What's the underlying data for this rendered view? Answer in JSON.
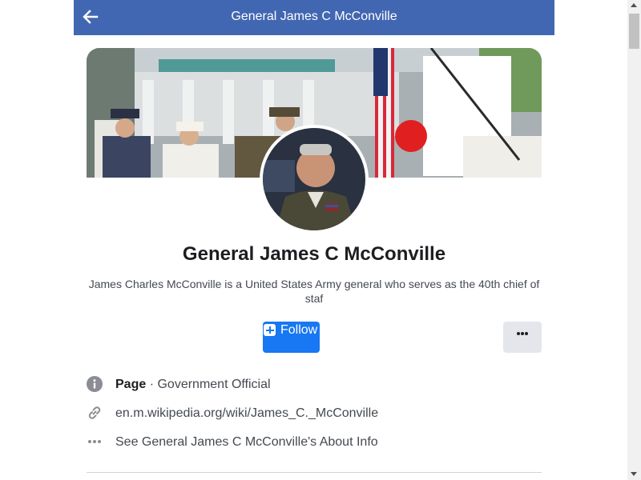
{
  "header": {
    "title": "General James C McConville"
  },
  "profile": {
    "name": "General James C McConville",
    "description": "James Charles McConville is a United States Army general who serves as the 40th chief of staf"
  },
  "actions": {
    "follow_label": "Follow",
    "more_icon": "more-dots-icon"
  },
  "info": {
    "page_label": "Page",
    "separator": " · ",
    "category": "Government Official",
    "website": "en.m.wikipedia.org/wiki/James_C._McConville",
    "about_link": "See General James C McConville's About Info"
  },
  "colors": {
    "header_bg": "#4267b2",
    "follow_bg": "#1877f2",
    "more_bg": "#e4e6eb"
  }
}
